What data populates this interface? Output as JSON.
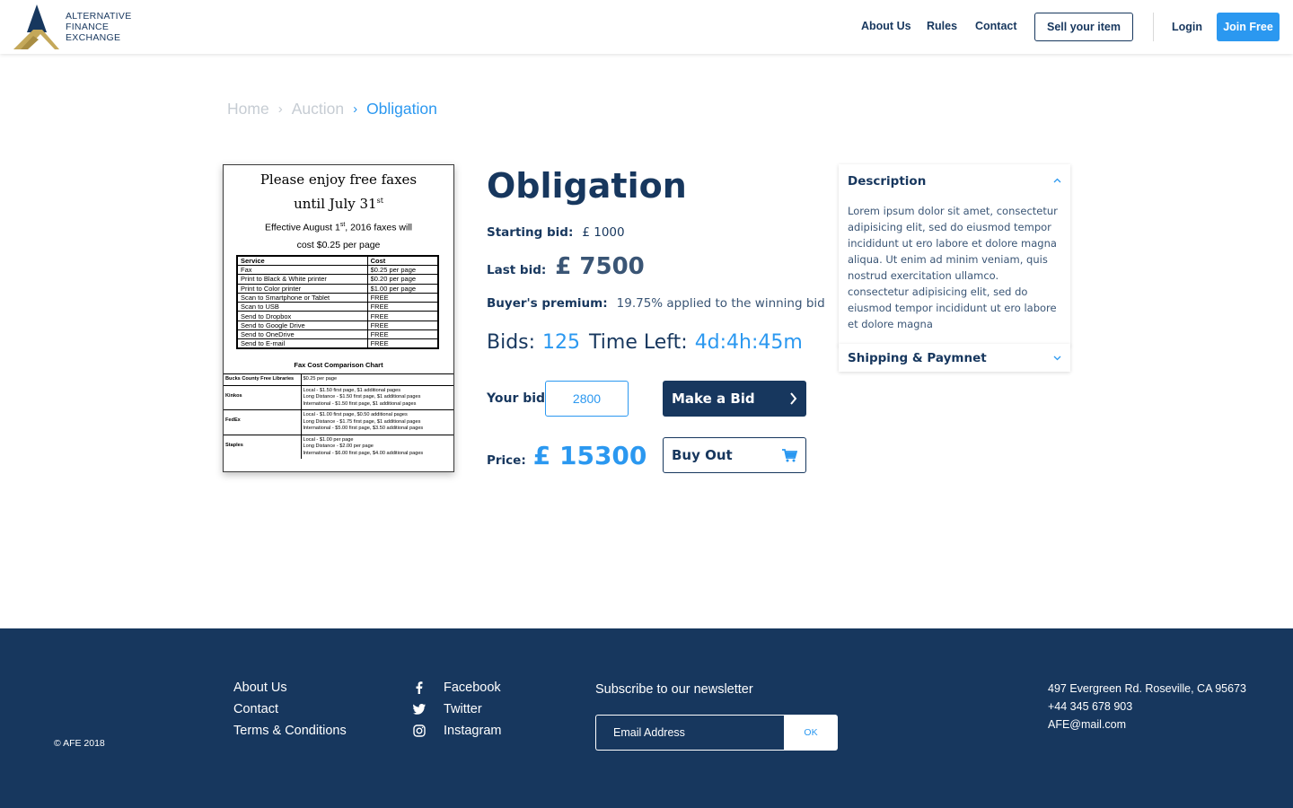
{
  "brand": {
    "line1": "ALTERNATIVE",
    "line2": "FINANCE",
    "line3": "EXCHANGE",
    "colors": {
      "navy": "#17375e",
      "gold": "#c4a85a",
      "blue": "#2b98f0"
    }
  },
  "nav": {
    "about": "About Us",
    "rules": "Rules",
    "contact": "Contact",
    "sell": "Sell your item",
    "login": "Login",
    "join": "Join Free"
  },
  "breadcrumb": [
    "Home",
    "Auction",
    "Obligation"
  ],
  "product": {
    "image": {
      "heading_line1": "Please enjoy free faxes",
      "heading_line2": "until July 31",
      "heading_sup": "st",
      "effective_pre": "Effective August 1",
      "effective_sup": "st",
      "effective_post": ", 2016 faxes will",
      "effective_line2": "cost $0.25 per page",
      "table_headers": [
        "Service",
        "Cost"
      ],
      "table_rows": [
        [
          "Fax",
          "$0.25 per page"
        ],
        [
          "Print to Black & White printer",
          "$0.20 per page"
        ],
        [
          "Print to Color printer",
          "$1.00 per page"
        ],
        [
          "Scan to Smartphone or Tablet",
          "FREE"
        ],
        [
          "Scan to USB",
          "FREE"
        ],
        [
          "Send to Dropbox",
          "FREE"
        ],
        [
          "Send to Google Drive",
          "FREE"
        ],
        [
          "Send to OneDrive",
          "FREE"
        ],
        [
          "Send to E-mail",
          "FREE"
        ]
      ],
      "comparison_title": "Fax Cost Comparison Chart",
      "comparison_rows": [
        {
          "name": "Bucks County Free Libraries",
          "lines": [
            "$0.25 per page"
          ]
        },
        {
          "name": "Kinkos",
          "lines": [
            "Local - $1.50 first page, $1 additional pages",
            "Long Distance - $1.50 first page, $1 additional pages",
            "International - $1.50 first page, $1 additional pages"
          ]
        },
        {
          "name": "FedEx",
          "lines": [
            "Local - $1.00 first page, $0.50 additional pages",
            "Long Distance - $1.75 first page, $1 additional pages",
            "International - $5.00 first page, $3.50 additional pages"
          ]
        },
        {
          "name": "Staples",
          "lines": [
            "Local - $1.00 per page",
            "Long Distance - $2.00 per page",
            "International - $6.00 first page, $4.00 additional pages"
          ]
        }
      ]
    },
    "title": "Obligation",
    "starting_bid_label": "Starting bid:",
    "starting_bid_value": "£ 1000",
    "last_bid_label": "Last bid:",
    "last_bid_value": "£ 7500",
    "premium_label": "Buyer's premium:",
    "premium_value": "19.75% applied to the winning bid",
    "bids_label": "Bids:",
    "bids_value": "125",
    "time_left_label": "Time Left:",
    "time_left_value": "4d:4h:45m",
    "your_bid_label": "Your bid:",
    "your_bid_value": "2800",
    "make_bid_label": "Make a Bid",
    "price_label": "Price:",
    "price_value": "£ 15300",
    "buy_out_label": "Buy Out"
  },
  "accordion": {
    "description_title": "Description",
    "description_text": "Lorem ipsum dolor sit amet, consectetur adipisicing elit, sed do eiusmod tempor incididunt ut ero labore et dolore magna aliqua. Ut enim ad minim veniam, quis nostrud exercitation ullamco. consectetur adipisicing elit, sed do eiusmod tempor incididunt ut ero labore et dolore magna",
    "shipping_title": "Shipping & Paymnet"
  },
  "footer": {
    "copyright": "© AFE 2018",
    "links": [
      "About Us",
      "Contact",
      "Terms & Conditions"
    ],
    "social": [
      {
        "icon": "facebook-icon",
        "label": "Facebook"
      },
      {
        "icon": "twitter-icon",
        "label": "Twitter"
      },
      {
        "icon": "instagram-icon",
        "label": "Instagram"
      }
    ],
    "newsletter_title": "Subscribe to our newsletter",
    "email_placeholder": "Email Address",
    "ok_label": "OK",
    "address": "497 Evergreen Rd. Roseville, CA 95673",
    "phone": "+44 345 678 903",
    "email": "AFE@mail.com"
  }
}
